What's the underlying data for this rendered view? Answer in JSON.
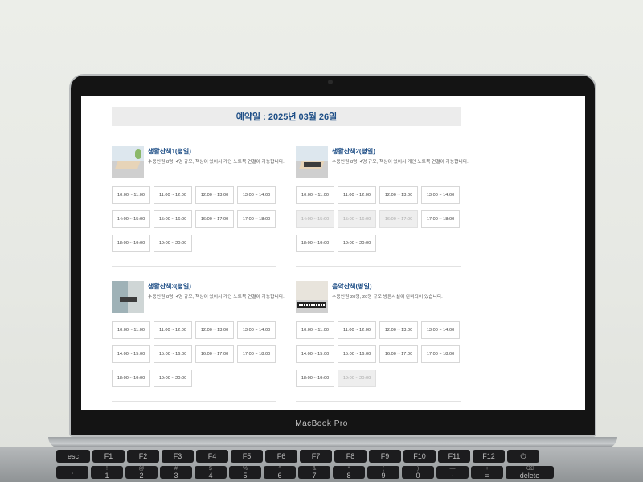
{
  "banner": {
    "text": "예약일 : 2025년 03월 26일"
  },
  "rooms": [
    {
      "name": "생활산책1(평일)",
      "desc": "수용인원 8명, 4명 규모, 책상이 있어서 개인 노트북 연결이 가능합니다.",
      "slots": [
        {
          "label": "10:00 ~ 11:00",
          "disabled": false
        },
        {
          "label": "11:00 ~ 12:00",
          "disabled": false
        },
        {
          "label": "12:00 ~ 13:00",
          "disabled": false
        },
        {
          "label": "13:00 ~ 14:00",
          "disabled": false
        },
        {
          "label": "14:00 ~ 15:00",
          "disabled": false
        },
        {
          "label": "15:00 ~ 16:00",
          "disabled": false
        },
        {
          "label": "16:00 ~ 17:00",
          "disabled": false
        },
        {
          "label": "17:00 ~ 18:00",
          "disabled": false
        },
        {
          "label": "18:00 ~ 19:00",
          "disabled": false
        },
        {
          "label": "19:00 ~ 20:00",
          "disabled": false
        }
      ]
    },
    {
      "name": "생활산책2(평일)",
      "desc": "수용인원 8명, 4명 규모, 책상이 있어서 개인 노트북 연결이 가능합니다.",
      "slots": [
        {
          "label": "10:00 ~ 11:00",
          "disabled": false
        },
        {
          "label": "11:00 ~ 12:00",
          "disabled": false
        },
        {
          "label": "12:00 ~ 13:00",
          "disabled": false
        },
        {
          "label": "13:00 ~ 14:00",
          "disabled": false
        },
        {
          "label": "14:00 ~ 15:00",
          "disabled": true
        },
        {
          "label": "15:00 ~ 16:00",
          "disabled": true
        },
        {
          "label": "16:00 ~ 17:00",
          "disabled": true
        },
        {
          "label": "17:00 ~ 18:00",
          "disabled": false
        },
        {
          "label": "18:00 ~ 19:00",
          "disabled": false
        },
        {
          "label": "19:00 ~ 20:00",
          "disabled": false
        }
      ]
    },
    {
      "name": "생활산책3(평일)",
      "desc": "수용인원 8명, 4명 규모, 책상이 있어서 개인 노트북 연결이 가능합니다.",
      "slots": [
        {
          "label": "10:00 ~ 11:00",
          "disabled": false
        },
        {
          "label": "11:00 ~ 12:00",
          "disabled": false
        },
        {
          "label": "12:00 ~ 13:00",
          "disabled": false
        },
        {
          "label": "13:00 ~ 14:00",
          "disabled": false
        },
        {
          "label": "14:00 ~ 15:00",
          "disabled": false
        },
        {
          "label": "15:00 ~ 16:00",
          "disabled": false
        },
        {
          "label": "16:00 ~ 17:00",
          "disabled": false
        },
        {
          "label": "17:00 ~ 18:00",
          "disabled": false
        },
        {
          "label": "18:00 ~ 19:00",
          "disabled": false
        },
        {
          "label": "19:00 ~ 20:00",
          "disabled": false
        }
      ]
    },
    {
      "name": "음악산책(평일)",
      "desc": "수용인원 20명, 20명 규모 방음시설이 완비되어 있습니다.",
      "slots": [
        {
          "label": "10:00 ~ 11:00",
          "disabled": false
        },
        {
          "label": "11:00 ~ 12:00",
          "disabled": false
        },
        {
          "label": "12:00 ~ 13:00",
          "disabled": false
        },
        {
          "label": "13:00 ~ 14:00",
          "disabled": false
        },
        {
          "label": "14:00 ~ 15:00",
          "disabled": false
        },
        {
          "label": "15:00 ~ 16:00",
          "disabled": false
        },
        {
          "label": "16:00 ~ 17:00",
          "disabled": false
        },
        {
          "label": "17:00 ~ 18:00",
          "disabled": false
        },
        {
          "label": "18:00 ~ 19:00",
          "disabled": false
        },
        {
          "label": "19:00 ~ 20:00",
          "disabled": true
        }
      ]
    }
  ],
  "device": {
    "brand": "MacBook Pro"
  },
  "keyboard": {
    "fn_row": [
      "esc",
      "F1",
      "F2",
      "F3",
      "F4",
      "F5",
      "F6",
      "F7",
      "F8",
      "F9",
      "F10",
      "F11",
      "F12",
      "⏻"
    ],
    "num_row_top": [
      "~",
      "!",
      "@",
      "#",
      "$",
      "%",
      "^",
      "&",
      "*",
      "(",
      ")",
      "—",
      "+",
      "⌫"
    ],
    "num_row_bottom": [
      "`",
      "1",
      "2",
      "3",
      "4",
      "5",
      "6",
      "7",
      "8",
      "9",
      "0",
      "-",
      "=",
      "delete"
    ]
  }
}
